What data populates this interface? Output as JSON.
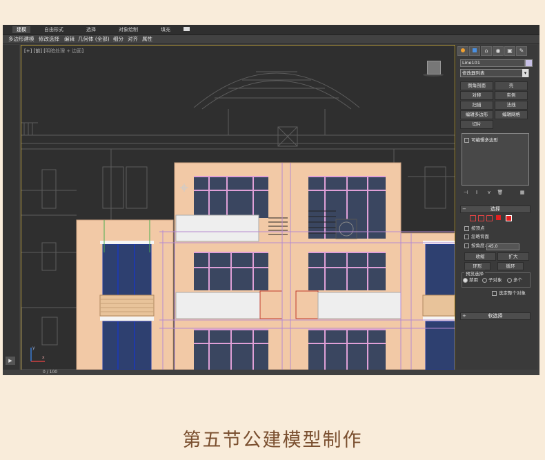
{
  "ribbon": {
    "tabs": [
      "建模",
      "自由形式",
      "选择",
      "对象绘制",
      "填充"
    ],
    "commands": [
      "多边形建模",
      "修改选择",
      "编辑",
      "几何体 (全部)",
      "细分",
      "对齐",
      "属性"
    ]
  },
  "viewport": {
    "label_prefix": "[+] [前] [",
    "label_mode": "明暗处理 + 边面",
    "label_suffix": "]",
    "axis_y": "y",
    "axis_x": "x"
  },
  "command_panel": {
    "tab_icons": [
      "create-icon",
      "modify-icon",
      "hierarchy-icon",
      "motion-icon",
      "display-icon",
      "utilities-icon"
    ],
    "object_name": "Line101",
    "object_color": "#c7c0e6",
    "modifier_list": "修改器列表",
    "modifier_buttons": [
      "倒角剖面",
      "壳",
      "对称",
      "实例",
      "扫描",
      "法线",
      "编辑多边形",
      "编辑网格",
      "切片"
    ],
    "stack_item": "可编辑多边形",
    "rollouts": {
      "selection": "选择",
      "soft_selection": "软选择"
    },
    "selection": {
      "by_vertex": "按顶点",
      "ignore_backfacing": "忽略背面",
      "by_angle": "按角度:",
      "angle_value": "45.0",
      "shrink": "收缩",
      "grow": "扩大",
      "ring": "环形",
      "loop": "循环",
      "preview_group": "预览选择",
      "preview_options": [
        "禁用",
        "子对象",
        "多个"
      ],
      "whole_object": "选定整个对象"
    }
  },
  "status": {
    "frame": "0 / 100"
  },
  "caption": "第五节公建模型制作"
}
